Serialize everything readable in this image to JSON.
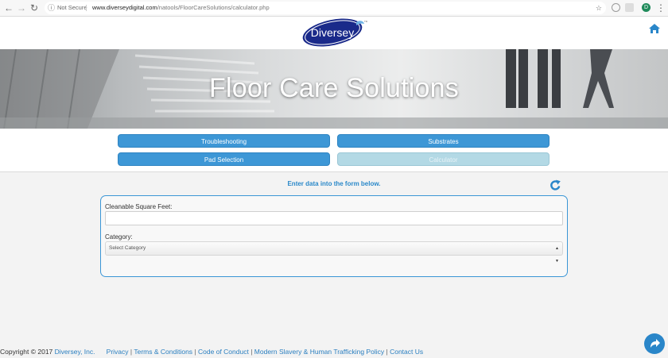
{
  "browser": {
    "security_label": "Not Secure",
    "url_domain": "www.diverseydigital.com",
    "url_path": "/natools/FloorCareSolutions/calculator.php",
    "profile_letter": "D"
  },
  "header": {
    "logo_text": "Diversey",
    "trademark": "TM"
  },
  "hero": {
    "title": "Floor Care Solutions"
  },
  "tabs": [
    {
      "label": "Troubleshooting",
      "active": false
    },
    {
      "label": "Substrates",
      "active": false
    },
    {
      "label": "Pad Selection",
      "active": false
    },
    {
      "label": "Calculator",
      "active": true
    }
  ],
  "main": {
    "instructions": "Enter data into the form below.",
    "form": {
      "square_feet_label": "Cleanable Square Feet:",
      "square_feet_value": "",
      "category_label": "Category:",
      "category_selected": "Select Category"
    }
  },
  "footer": {
    "copyright_prefix": "Copyright © 2017 ",
    "company_link": "Diversey, Inc.",
    "links": [
      "Privacy",
      "Terms & Conditions",
      "Code of Conduct",
      "Modern Slavery & Human Trafficking Policy",
      "Contact Us"
    ]
  },
  "colors": {
    "accent_blue": "#3d97d6",
    "active_tab": "#b3d9e5",
    "logo_blue": "#1a2a8a",
    "link_blue": "#2a7fc0"
  }
}
